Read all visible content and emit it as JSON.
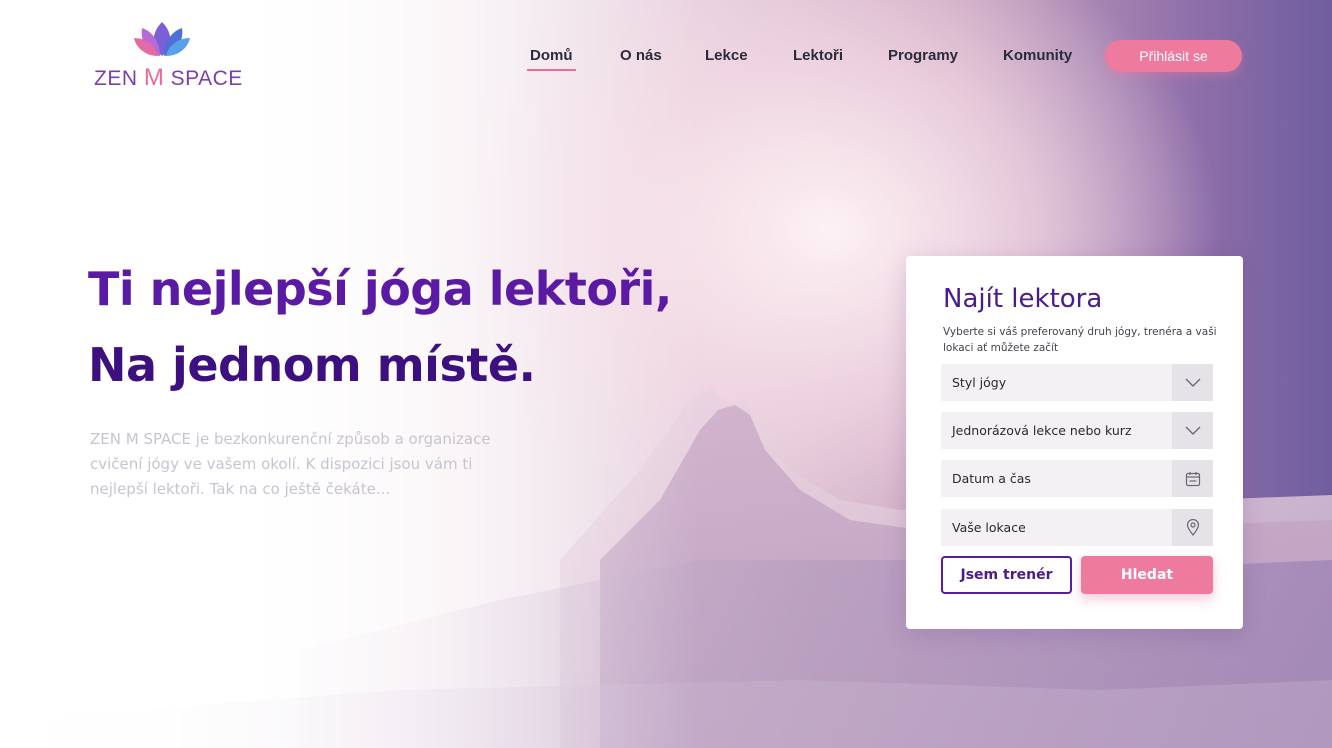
{
  "brand": {
    "logo_text_left": "ZEN ",
    "logo_text_m": "M",
    "logo_text_right": " SPACE",
    "logo_icon": "lotus-icon",
    "primary_color": "#5a1aa3",
    "accent_color": "#ee7a9e"
  },
  "nav": {
    "items": [
      {
        "label": "Domů",
        "active": true
      },
      {
        "label": "O nás"
      },
      {
        "label": "Lekce"
      },
      {
        "label": "Lektoři"
      },
      {
        "label": "Programy"
      },
      {
        "label": "Komunity"
      }
    ],
    "login_label": "Přihlásit se"
  },
  "hero": {
    "title_line1": "Ti nejlepší jóga lektoři,",
    "title_line2": "Na jednom místě.",
    "description": "ZEN M SPACE je bezkonkurenční způsob a organizace cvičení jógy ve vašem okolí. K dispozici jsou  vám ti nejlepší lektoři. Tak na co ještě čekáte..."
  },
  "finder": {
    "title": "Najít lektora",
    "subtitle": "Vyberte si váš preferovaný druh jógy,  trenéra a vaši lokaci ať můžete začít",
    "fields": [
      {
        "label": "Styl jógy",
        "icon": "chevron-down-icon"
      },
      {
        "label": "Jednorázová lekce nebo kurz",
        "icon": "chevron-down-icon"
      },
      {
        "label": "Datum a čas",
        "icon": "calendar-icon"
      },
      {
        "label": "Vaše lokace",
        "icon": "location-pin-icon"
      }
    ],
    "trainer_button": "Jsem trenér",
    "search_button": "Hledat"
  }
}
